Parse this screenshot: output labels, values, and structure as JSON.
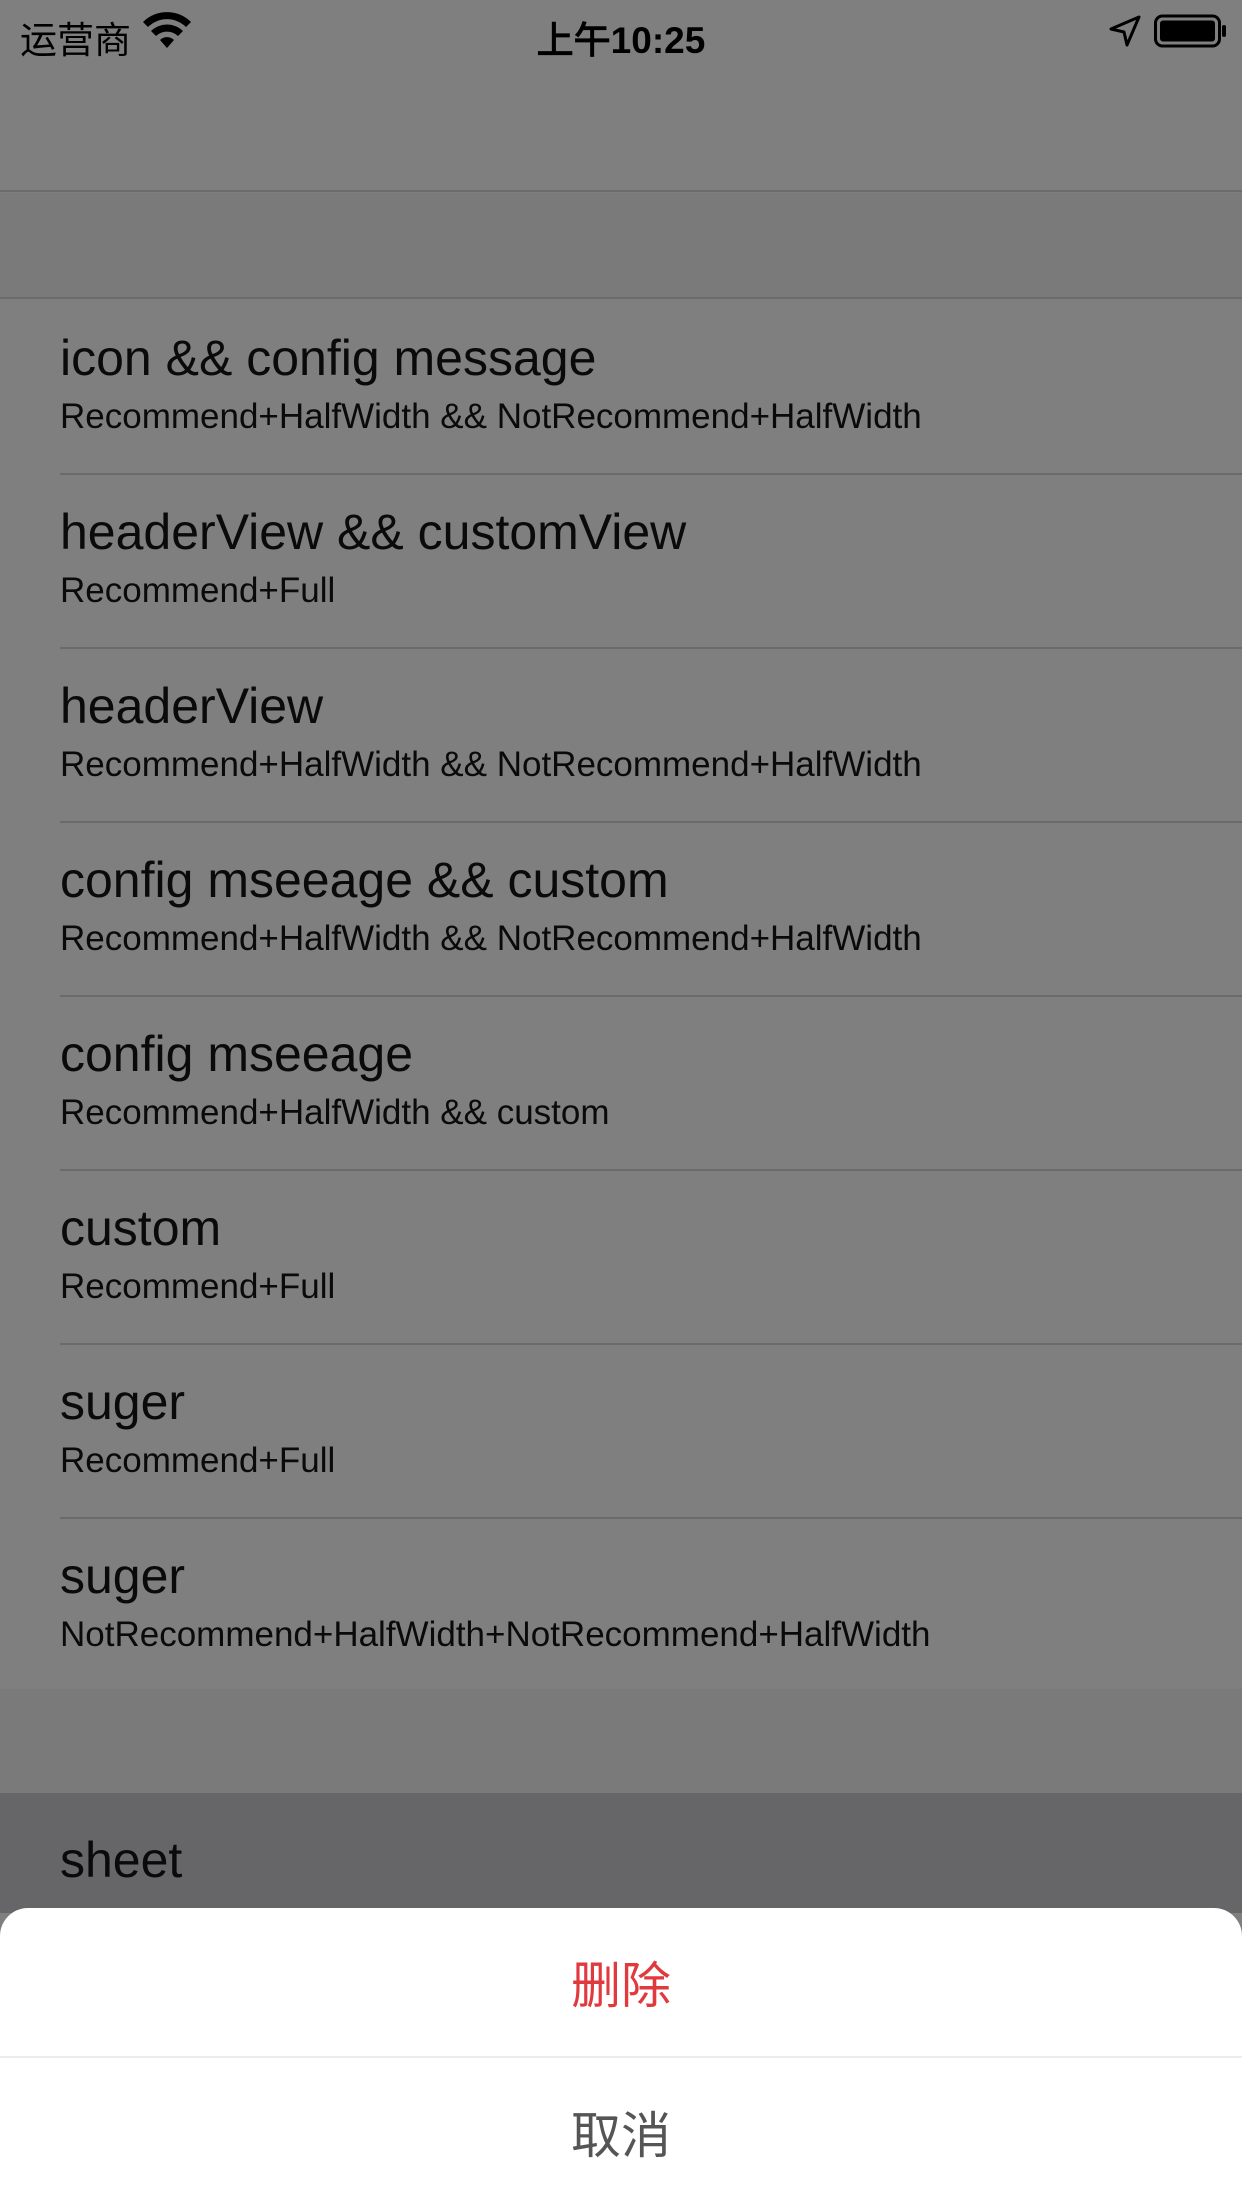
{
  "status_bar": {
    "carrier": "运营商",
    "time": "上午10:25",
    "icons": [
      "wifi-icon",
      "location-arrow-icon",
      "battery-icon"
    ]
  },
  "list": {
    "items": [
      {
        "title": "icon && config message",
        "subtitle": "Recommend+HalfWidth && NotRecommend+HalfWidth"
      },
      {
        "title": "headerView && customView",
        "subtitle": "Recommend+Full"
      },
      {
        "title": "headerView",
        "subtitle": "Recommend+HalfWidth && NotRecommend+HalfWidth"
      },
      {
        "title": "config mseeage && custom",
        "subtitle": "Recommend+HalfWidth && NotRecommend+HalfWidth"
      },
      {
        "title": "config mseeage",
        "subtitle": "Recommend+HalfWidth && custom"
      },
      {
        "title": "custom",
        "subtitle": "Recommend+Full"
      },
      {
        "title": "suger",
        "subtitle": "Recommend+Full"
      },
      {
        "title": "suger",
        "subtitle": "NotRecommend+HalfWidth+NotRecommend+HalfWidth"
      }
    ]
  },
  "sheet_row": {
    "label": "sheet"
  },
  "action_sheet": {
    "delete_label": "删除",
    "cancel_label": "取消"
  },
  "colors": {
    "dim_background": "#7f7f7f",
    "destructive": "#e0393e",
    "cancel_text": "#555555",
    "sheet_background": "#ffffff"
  }
}
